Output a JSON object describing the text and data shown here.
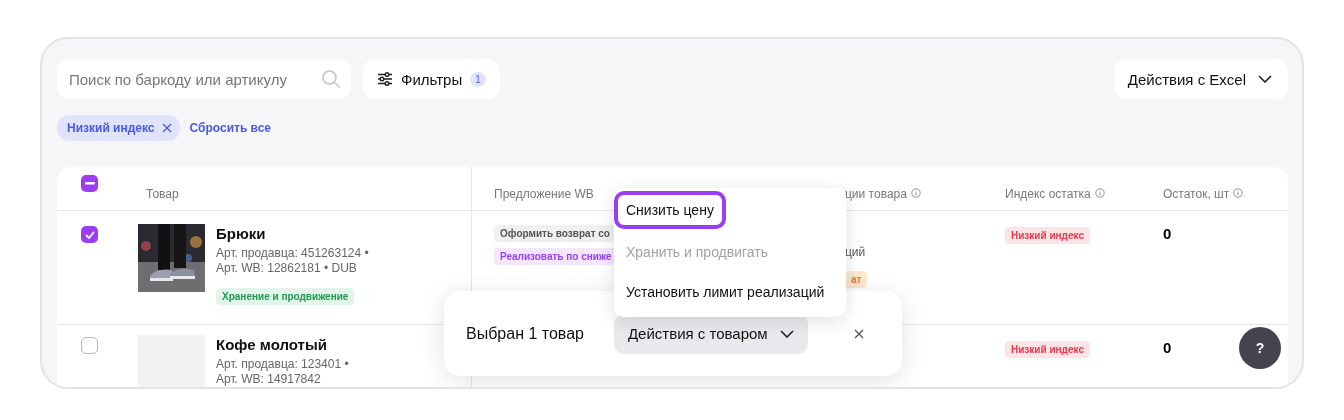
{
  "toolbar": {
    "search": {
      "placeholder": "Поиск по баркоду или артикулу"
    },
    "filters": {
      "label": "Фильтры",
      "count": "1"
    },
    "excel": {
      "label": "Действия с Excel"
    }
  },
  "chips": [
    {
      "label": "Низкий индекс"
    }
  ],
  "reset_link": "Сбросить все",
  "table": {
    "header_checkbox": {
      "indeterminate": true
    },
    "columns": [
      {
        "label": "Товар",
        "info": false
      },
      {
        "label": "Предложение WB",
        "info": false
      },
      {
        "label": "ции товара",
        "info": true
      },
      {
        "label": "Индекс остатка",
        "info": true
      },
      {
        "label": "Остаток, шт",
        "info": true
      }
    ],
    "rows": [
      {
        "selected": true,
        "image": {
          "kind": "picture"
        },
        "name": "Брюки",
        "seller_article": "Арт. продавца: 451263124 •",
        "wb_article": "Арт. WB: 12862181 • DUB",
        "tags": [
          {
            "label": "Хранение и продвижение",
            "kind": "success"
          }
        ],
        "offers": [
          {
            "label": "Оформить возврат со",
            "kind": "neutral"
          },
          {
            "label": "Реализовать по сниже",
            "kind": "accent"
          }
        ],
        "column_3": [
          {
            "kind": "text",
            "text": "ций"
          },
          {
            "kind": "badge",
            "text": "ат"
          }
        ],
        "index": {
          "label": "Низкий индекс",
          "kind": "danger"
        },
        "stock": "0"
      },
      {
        "selected": false,
        "image": {
          "kind": "picture"
        },
        "name": "Кофе молотый",
        "seller_article": "Арт. продавца: 123401 •",
        "wb_article": "Арт. WB: 14917842",
        "tags": [],
        "offers": [],
        "column_3": [],
        "index": {
          "label": "Низкий индекс",
          "kind": "danger"
        },
        "stock": "0"
      }
    ]
  },
  "selection_bar": {
    "text": "Выбран 1 товар",
    "action": {
      "label": "Действия с товаром",
      "expanded": true
    }
  },
  "menu": [
    {
      "label": "Снизить цену",
      "focused": true,
      "disabled": false
    },
    {
      "label": "Хранить и продвигать",
      "focused": false,
      "disabled": true
    },
    {
      "label": "Установить лимит реализаций",
      "focused": false,
      "disabled": false
    }
  ],
  "help_button": {
    "label": "?"
  }
}
